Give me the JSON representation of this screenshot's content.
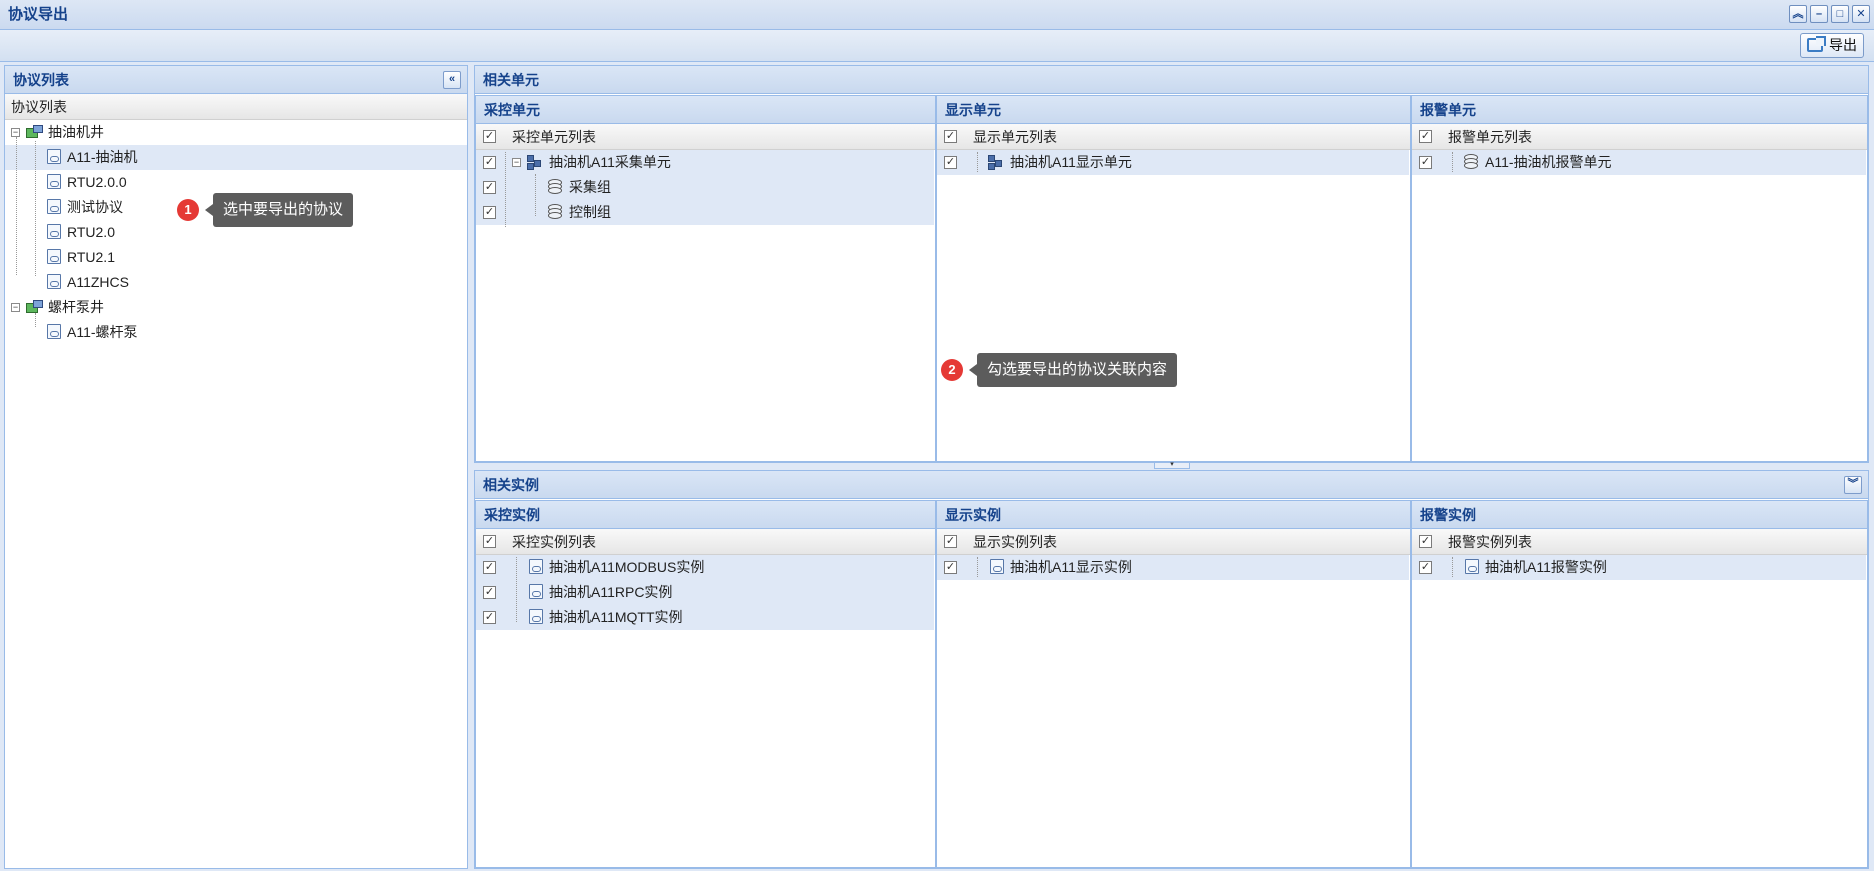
{
  "window": {
    "title": "协议导出",
    "tool_icons": [
      "collapse-up-icon",
      "minimize-icon",
      "maximize-icon",
      "close-icon"
    ]
  },
  "toolbar": {
    "export_label": "导出",
    "export_icon": "export-icon"
  },
  "protocol_panel": {
    "title": "协议列表",
    "column_header": "协议列表",
    "groups": [
      {
        "label": "抽油机井",
        "icon": "well-group-icon",
        "items": [
          "A11-抽油机",
          "RTU2.0.0",
          "测试协议",
          "RTU2.0",
          "RTU2.1",
          "A11ZHCS"
        ]
      },
      {
        "label": "螺杆泵井",
        "icon": "well-group-icon",
        "items": [
          "A11-螺杆泵"
        ]
      }
    ],
    "selected_item": "A11-抽油机"
  },
  "units_panel": {
    "title": "相关单元",
    "acq": {
      "title": "采控单元",
      "header": "采控单元列表",
      "root": "抽油机A11采集单元",
      "children": [
        "采集组",
        "控制组"
      ]
    },
    "display": {
      "title": "显示单元",
      "header": "显示单元列表",
      "items": [
        "抽油机A11显示单元"
      ]
    },
    "alarm": {
      "title": "报警单元",
      "header": "报警单元列表",
      "items": [
        "A11-抽油机报警单元"
      ]
    }
  },
  "instances_panel": {
    "title": "相关实例",
    "acq": {
      "title": "采控实例",
      "header": "采控实例列表",
      "items": [
        "抽油机A11MODBUS实例",
        "抽油机A11RPC实例",
        "抽油机A11MQTT实例"
      ]
    },
    "display": {
      "title": "显示实例",
      "header": "显示实例列表",
      "items": [
        "抽油机A11显示实例"
      ]
    },
    "alarm": {
      "title": "报警实例",
      "header": "报警实例列表",
      "items": [
        "抽油机A11报警实例"
      ]
    }
  },
  "callouts": [
    {
      "number": "1",
      "text": "选中要导出的协议"
    },
    {
      "number": "2",
      "text": "勾选要导出的协议关联内容"
    }
  ],
  "checkbox_state": "checked",
  "colors": {
    "header_text": "#15428b",
    "border": "#99bbe8",
    "selection": "#dfe8f6",
    "badge": "#e53935"
  }
}
